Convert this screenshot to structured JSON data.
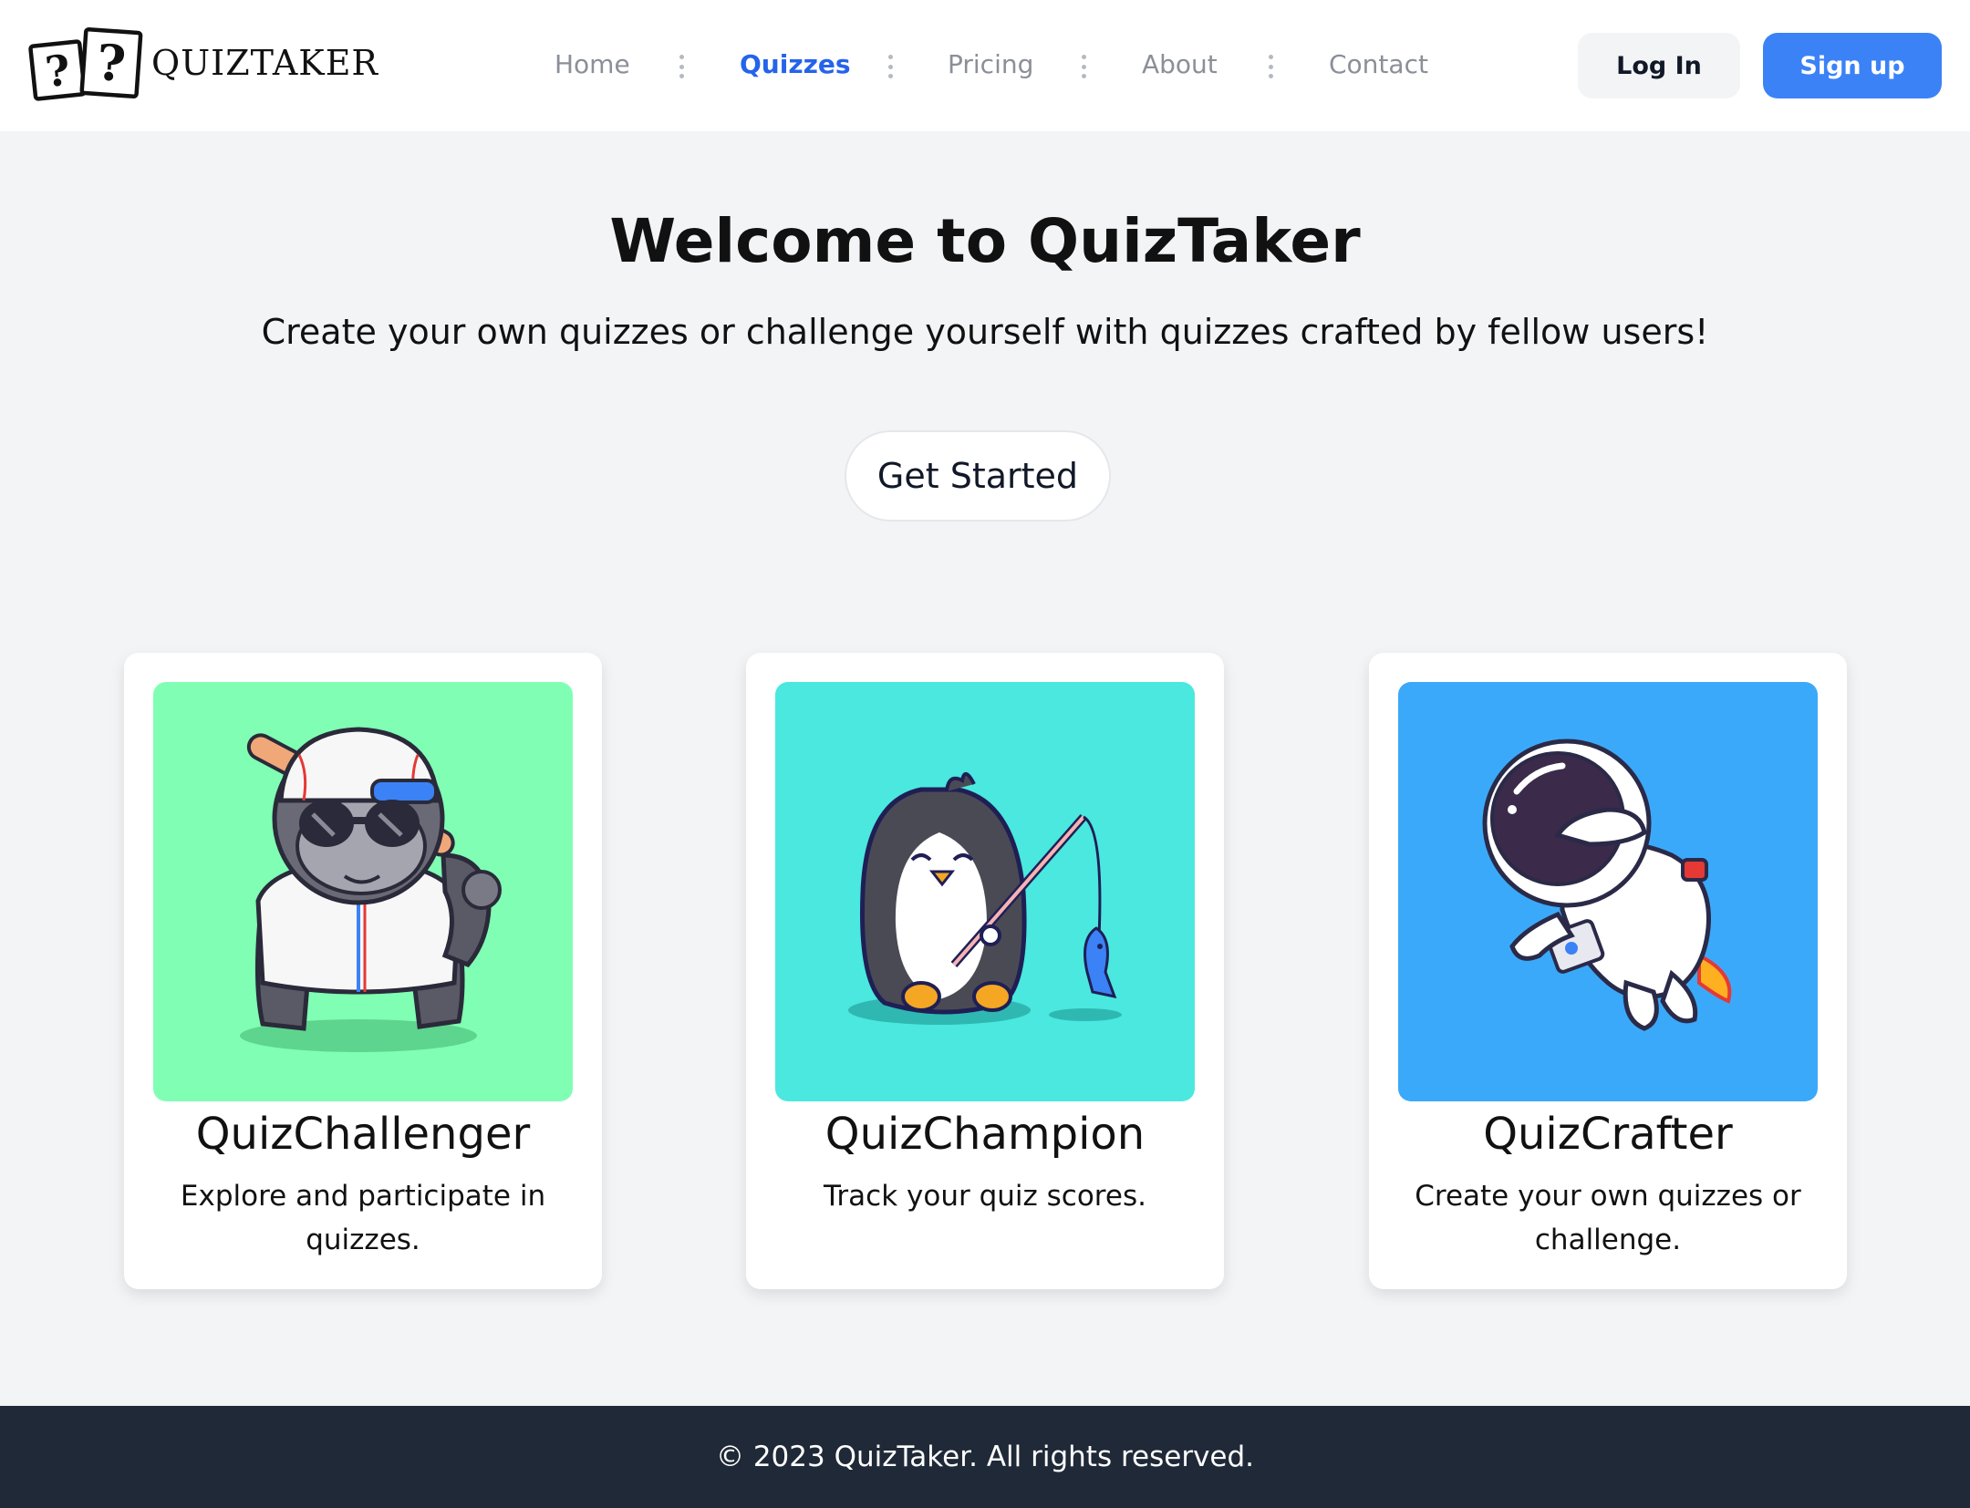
{
  "brand": {
    "name": "QUIZTAKER",
    "logo_icon": "question-cards-icon"
  },
  "nav": {
    "items": [
      {
        "label": "Home",
        "active": false
      },
      {
        "label": "Quizzes",
        "active": true
      },
      {
        "label": "Pricing",
        "active": false
      },
      {
        "label": "About",
        "active": false
      },
      {
        "label": "Contact",
        "active": false
      }
    ],
    "separator_icon": "vertical-ellipsis-icon"
  },
  "auth": {
    "login_label": "Log In",
    "signup_label": "Sign up"
  },
  "hero": {
    "title": "Welcome to QuizTaker",
    "subtitle": "Create your own quizzes or challenge yourself with quizzes crafted by fellow users!",
    "cta_label": "Get Started"
  },
  "cards": [
    {
      "title": "QuizChallenger",
      "description": "Explore and participate in quizzes.",
      "illustration": "gorilla-baseball-illustration",
      "bg_color": "#80ffb4"
    },
    {
      "title": "QuizChampion",
      "description": "Track your quiz scores.",
      "illustration": "penguin-fishing-illustration",
      "bg_color": "#4ae8df"
    },
    {
      "title": "QuizCrafter",
      "description": "Create your own quizzes or challenge.",
      "illustration": "astronaut-flying-illustration",
      "bg_color": "#3ba9fa"
    }
  ],
  "footer": {
    "text": "© 2023 QuizTaker. All rights reserved."
  },
  "colors": {
    "accent": "#3b82f6",
    "nav_active": "#2563eb",
    "footer_bg": "#1f2937",
    "page_bg": "#f3f4f6"
  }
}
